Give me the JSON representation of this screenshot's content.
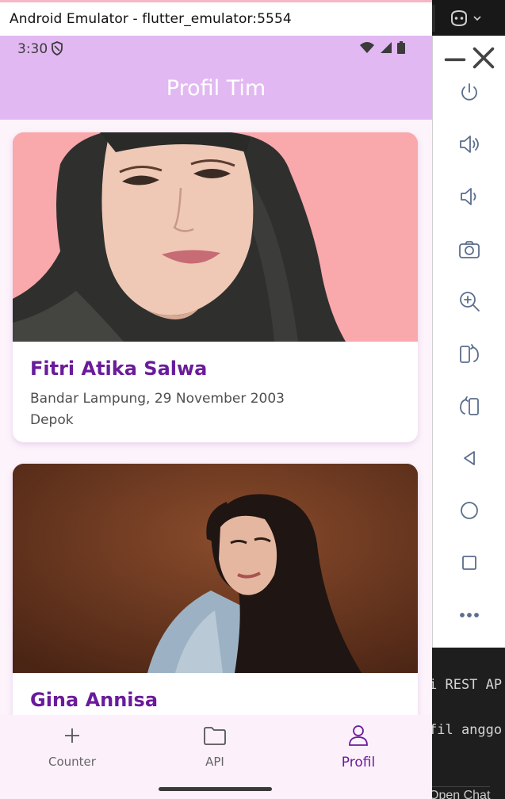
{
  "window": {
    "title": "Android Emulator - flutter_emulator:5554"
  },
  "status_bar": {
    "time": "3:30"
  },
  "app_bar": {
    "title": "Profil Tim"
  },
  "profiles": [
    {
      "name": "Fitri Atika Salwa",
      "birth": "Bandar Lampung, 29 November 2003",
      "city": "Depok",
      "photo_bg": "#f9a8ab"
    },
    {
      "name": "Gina Annisa",
      "photo_bg": "#6b3a22"
    }
  ],
  "bottom_nav": {
    "items": [
      {
        "label": "Counter",
        "icon": "plus-icon"
      },
      {
        "label": "API",
        "icon": "folder-icon"
      },
      {
        "label": "Profil",
        "icon": "person-icon"
      }
    ],
    "active": "Profil"
  },
  "emulator_tools": [
    "power-icon",
    "volume-up-icon",
    "volume-down-icon",
    "camera-icon",
    "zoom-icon",
    "rotate-left-icon",
    "rotate-right-icon",
    "back-icon",
    "home-icon",
    "overview-icon",
    "more-icon"
  ],
  "ide_snippets": {
    "line1": "i REST AP",
    "line2": "fil anggo",
    "line3": "Open Chat"
  },
  "colors": {
    "accent": "#6a1b9a",
    "app_bar": "#e2b8f2",
    "background": "#fdf4fb"
  }
}
